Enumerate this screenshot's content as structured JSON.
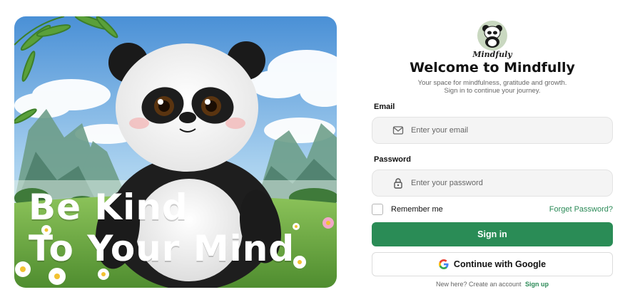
{
  "hero": {
    "line1": "Be Kind",
    "line2": "To Your Mind"
  },
  "brand": {
    "logo_text": "Mindfuly",
    "title": "Welcome to Mindfully",
    "subtitle_line1": "Your space for mindfulness, gratitude and growth.",
    "subtitle_line2": "Sign in to continue your journey."
  },
  "form": {
    "email_label": "Email",
    "email_placeholder": "Enter your email",
    "email_value": "",
    "password_label": "Password",
    "password_placeholder": "Enter your password",
    "password_value": "",
    "remember_label": "Remember me",
    "remember_checked": false,
    "forgot_label": "Forget Password?",
    "signin_label": "Sign in",
    "google_label": "Continue with Google",
    "signup_prompt": "New here? Create an account",
    "signup_link": "Sign up"
  },
  "colors": {
    "accent": "#2a8c56",
    "link": "#2b8a57",
    "field_bg": "#f4f4f4"
  },
  "icons": {
    "email": "mail-icon",
    "password": "lock-icon",
    "google": "google-icon"
  }
}
